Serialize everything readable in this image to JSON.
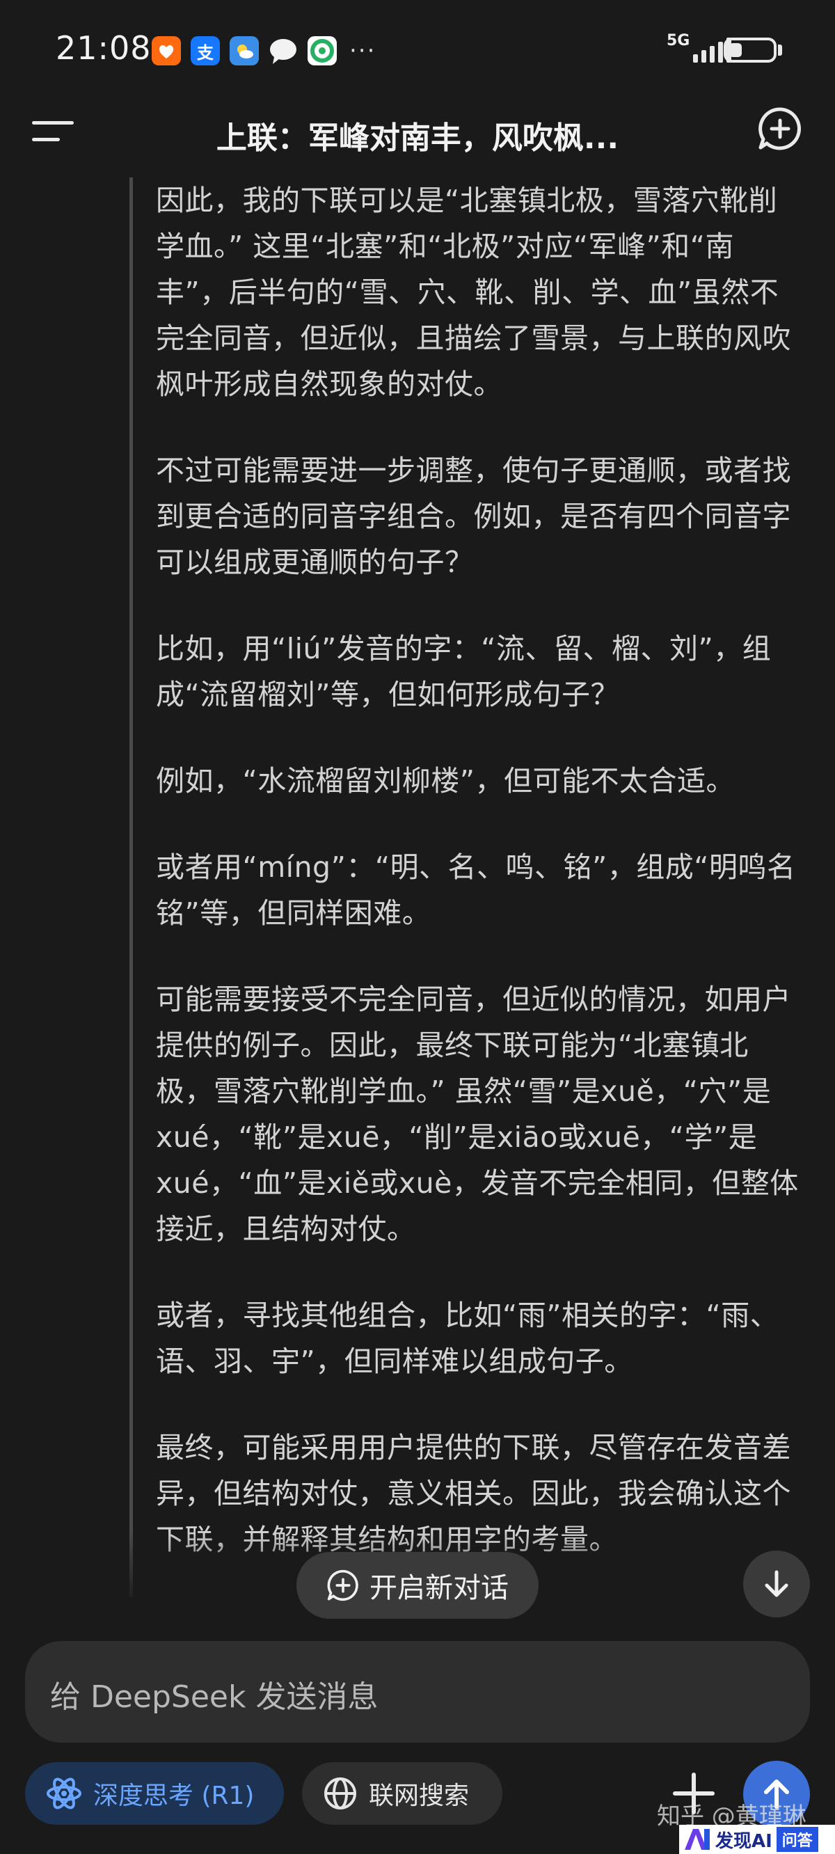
{
  "status_bar": {
    "time": "21:08",
    "network": "5G",
    "more": "···",
    "battery_level": 0.3,
    "app_icons": [
      "taobao-icon",
      "alipay-icon",
      "weather-icon",
      "chat-bubble-icon",
      "green-app-icon"
    ]
  },
  "header": {
    "title": "上联：军峰对南丰，风吹枫..."
  },
  "thinking": {
    "paragraphs": [
      "因此，我的下联可以是“北塞镇北极，雪落穴靴削学血。” 这里“北塞”和“北极”对应“军峰”和“南丰”，后半句的“雪、穴、靴、削、学、血”虽然不完全同音，但近似，且描绘了雪景，与上联的风吹枫叶形成自然现象的对仗。",
      "不过可能需要进一步调整，使句子更通顺，或者找到更合适的同音字组合。例如，是否有四个同音字可以组成更通顺的句子？",
      "比如，用“liú”发音的字：“流、留、榴、刘”，组成“流留榴刘”等，但如何形成句子？",
      "例如，“水流榴留刘柳楼”，但可能不太合适。",
      "或者用“míng”：“明、名、鸣、铭”，组成“明鸣名铭”等，但同样困难。",
      "可能需要接受不完全同音，但近似的情况，如用户提供的例子。因此，最终下联可能为“北塞镇北极，雪落穴靴削学血。” 虽然“雪”是xuě，“穴”是xué，“靴”是xuē，“削”是xiāo或xuē，“学”是xué，“血”是xiě或xuè，发音不完全相同，但整体接近，且结构对仗。",
      "或者，寻找其他组合，比如“雨”相关的字：“雨、语、羽、宇”，但同样难以组成句子。",
      "最终，可能采用用户提供的下联，尽管存在发音差异，但结构对仗，意义相关。因此，我会确认这个下联，并解释其结构和用字的考量。"
    ]
  },
  "new_chat_button": {
    "label": "开启新对话"
  },
  "input": {
    "placeholder": "给 DeepSeek 发送消息"
  },
  "toolbar": {
    "deep_think_label": "深度思考 (R1)",
    "web_search_label": "联网搜索"
  },
  "colors": {
    "background": "#1a1a1a",
    "accent_blue": "#3d6fd8",
    "deep_think_bg": "#1d3353",
    "deep_think_text": "#6aa5ff"
  },
  "watermarks": {
    "zhihu": "知乎 @黄瑾琳",
    "faxian_text": "发现AI",
    "faxian_badge": "问答"
  }
}
